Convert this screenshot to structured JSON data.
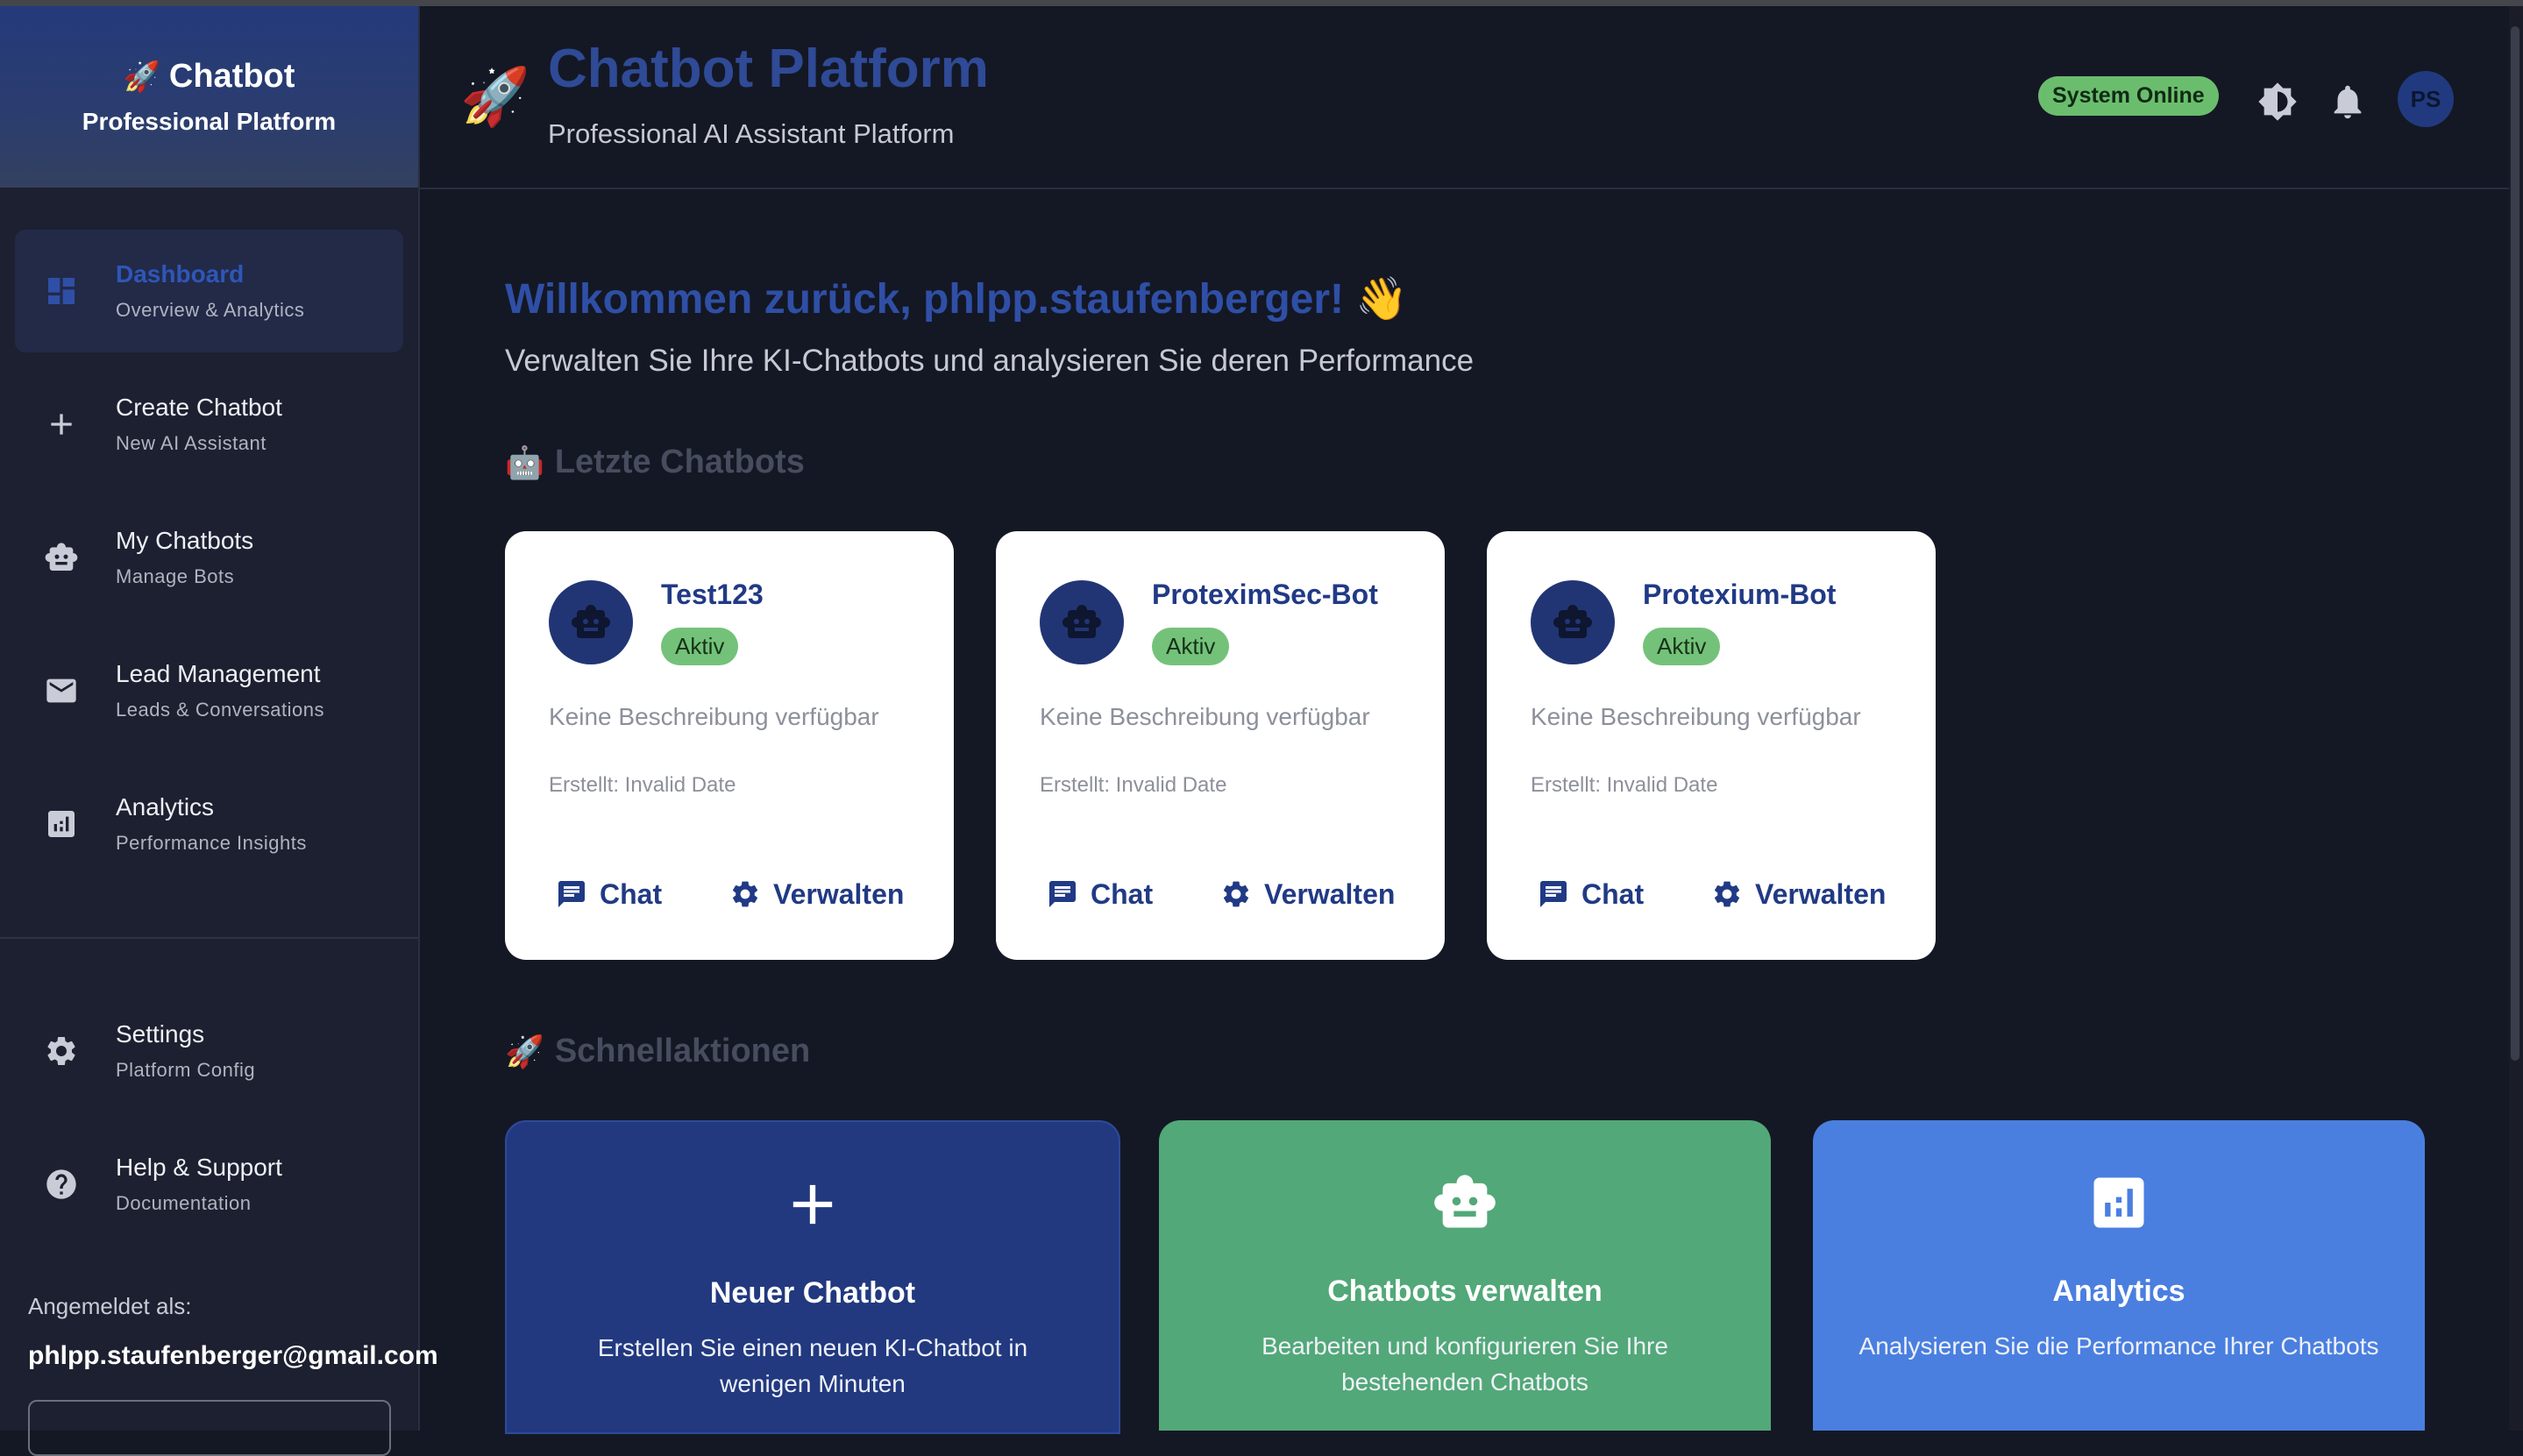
{
  "sidebar": {
    "brand_title": "Chatbot",
    "brand_subtitle": "Professional Platform",
    "items": [
      {
        "label": "Dashboard",
        "sub": "Overview & Analytics",
        "icon": "dashboard-icon"
      },
      {
        "label": "Create Chatbot",
        "sub": "New AI Assistant",
        "icon": "plus-icon"
      },
      {
        "label": "My Chatbots",
        "sub": "Manage Bots",
        "icon": "robot-icon"
      },
      {
        "label": "Lead Management",
        "sub": "Leads & Conversations",
        "icon": "mail-icon"
      },
      {
        "label": "Analytics",
        "sub": "Performance Insights",
        "icon": "analytics-icon"
      }
    ],
    "bottom_items": [
      {
        "label": "Settings",
        "sub": "Platform Config",
        "icon": "gear-icon"
      },
      {
        "label": "Help & Support",
        "sub": "Documentation",
        "icon": "help-icon"
      }
    ],
    "account_label": "Angemeldet als:",
    "account_email": "phlpp.staufenberger@gmail.com"
  },
  "header": {
    "title": "Chatbot Platform",
    "subtitle": "Professional AI Assistant Platform",
    "status": "System Online",
    "avatar_initials": "PS"
  },
  "main": {
    "welcome_title": "Willkommen zurück, phlpp.staufenberger! 👋",
    "welcome_subtitle": "Verwalten Sie Ihre KI-Chatbots und analysieren Sie deren Performance",
    "recent_title": "Letzte Chatbots",
    "quick_title": "Schnellaktionen",
    "bots": [
      {
        "name": "Test123",
        "status": "Aktiv",
        "description": "Keine Beschreibung verfügbar",
        "created": "Erstellt: Invalid Date",
        "chat_label": "Chat",
        "manage_label": "Verwalten"
      },
      {
        "name": "ProteximSec-Bot",
        "status": "Aktiv",
        "description": "Keine Beschreibung verfügbar",
        "created": "Erstellt: Invalid Date",
        "chat_label": "Chat",
        "manage_label": "Verwalten"
      },
      {
        "name": "Protexium-Bot",
        "status": "Aktiv",
        "description": "Keine Beschreibung verfügbar",
        "created": "Erstellt: Invalid Date",
        "chat_label": "Chat",
        "manage_label": "Verwalten"
      }
    ],
    "quick_actions": [
      {
        "title": "Neuer Chatbot",
        "description": "Erstellen Sie einen neuen KI-Chatbot in wenigen Minuten",
        "color": "#22397f",
        "icon": "plus-icon"
      },
      {
        "title": "Chatbots verwalten",
        "description": "Bearbeiten und konfigurieren Sie Ihre bestehenden Chatbots",
        "color": "#52a878",
        "icon": "robot-icon"
      },
      {
        "title": "Analytics",
        "description": "Analysieren Sie die Performance Ihrer Chatbots",
        "color": "#4a7fe0",
        "icon": "analytics-icon"
      }
    ]
  },
  "colors": {
    "accent": "#2f4fa6",
    "status_green": "#6bbd6e",
    "background": "#141824",
    "sidebar": "#1d2030"
  }
}
